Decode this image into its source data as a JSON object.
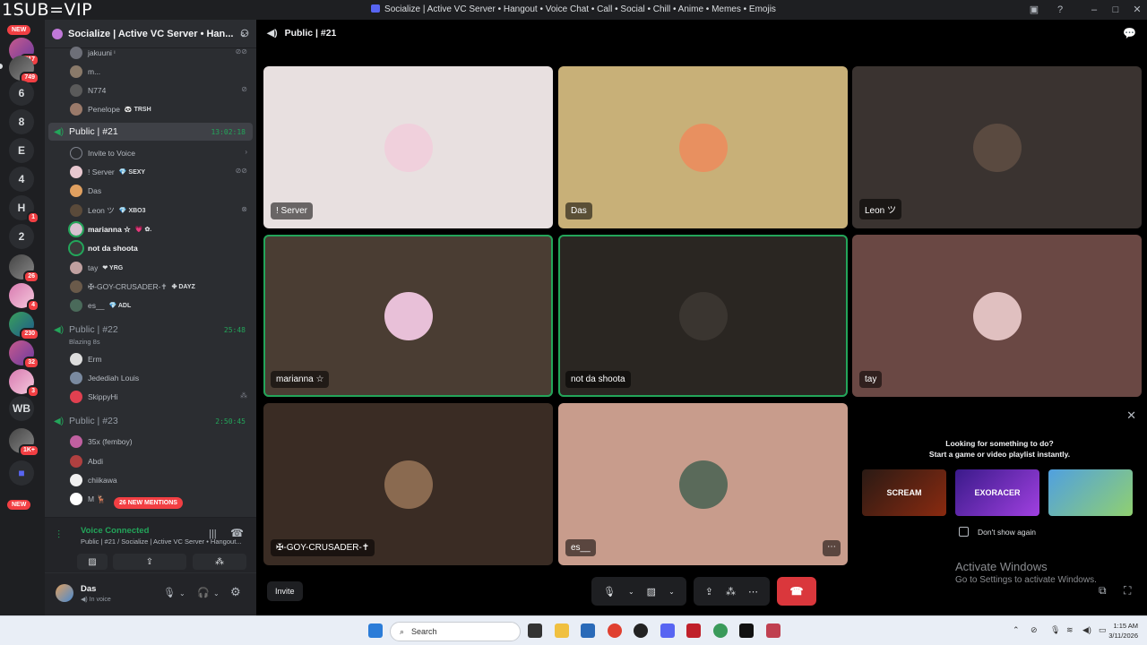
{
  "watermark": "1SUB=VIP",
  "window_title": "Socialize | Active VC Server • Hangout • Voice Chat • Call • Social • Chill • Anime • Memes • Emojis",
  "rail": {
    "new_top": "NEW",
    "new_bottom": "NEW",
    "items": [
      {
        "label": "",
        "badge": "517"
      },
      {
        "label": "",
        "badge": "749"
      },
      {
        "label": "6",
        "badge": ""
      },
      {
        "label": "8",
        "badge": ""
      },
      {
        "label": "E",
        "badge": ""
      },
      {
        "label": "4",
        "badge": ""
      },
      {
        "label": "H",
        "badge": "1"
      },
      {
        "label": "2",
        "badge": ""
      },
      {
        "label": "",
        "badge": "26"
      },
      {
        "label": "",
        "badge": "4"
      },
      {
        "label": "",
        "badge": "230"
      },
      {
        "label": "",
        "badge": "32"
      },
      {
        "label": "",
        "badge": "3"
      },
      {
        "label": "WB",
        "badge": ""
      },
      {
        "label": "",
        "badge": "1K+"
      }
    ]
  },
  "guild": {
    "name": "Socialize | Active VC Server • Han..."
  },
  "sidebar": {
    "top_users": [
      {
        "name": "jakuuni ᶦ",
        "color": "#6d6f78"
      },
      {
        "name": "m...",
        "color": "#8a7a6a"
      },
      {
        "name": "N774",
        "color": "#5a5a5a"
      },
      {
        "name": "Penelope",
        "tag": "🐼 TRSH",
        "color": "#9a7a6a"
      }
    ],
    "channel1": {
      "name": "Public | #21",
      "timer": "13:02:18"
    },
    "invite_label": "Invite to Voice",
    "ch1_users": [
      {
        "name": "! Server",
        "tag": "💎 SEXY",
        "color": "#e8c8d0",
        "bold": false
      },
      {
        "name": "Das",
        "tag": "",
        "color": "#e0a060",
        "bold": false
      },
      {
        "name": "Leon ツ",
        "tag": "💎 XBO3",
        "color": "#5a4a3a",
        "bold": false
      },
      {
        "name": "marianna ☆",
        "tag": "💗 ✿.",
        "color": "#d8c0d0",
        "bold": true
      },
      {
        "name": "not da shoota",
        "tag": "",
        "color": "#3a3a3a",
        "bold": true
      },
      {
        "name": "tay",
        "tag": "❤ YRG",
        "color": "#c0a0a0",
        "bold": false
      },
      {
        "name": "✠-GOY-CRUSADER-✝",
        "tag": "✤ DAYZ",
        "color": "#6a5a4a",
        "bold": false
      },
      {
        "name": "es__",
        "tag": "💎 ADL",
        "color": "#4a6a5a",
        "bold": false
      }
    ],
    "channel2": {
      "name": "Public | #22",
      "timer": "25:48",
      "sub": "Blazing 8s"
    },
    "ch2_users": [
      {
        "name": "Erm",
        "color": "#dddddd"
      },
      {
        "name": "Jedediah Louis",
        "color": "#7a8aa0"
      },
      {
        "name": "SkippyHi",
        "color": "#e04050"
      }
    ],
    "channel3": {
      "name": "Public | #23",
      "timer": "2:50:45"
    },
    "ch3_users": [
      {
        "name": "35x (femboy)",
        "color": "#c060a0"
      },
      {
        "name": "Abdi",
        "color": "#b04040"
      },
      {
        "name": "chiikawa",
        "color": "#f0f0f0"
      },
      {
        "name": "M 🦌",
        "color": "#ffffff"
      }
    ],
    "mentions": "26 NEW MENTIONS",
    "voice": {
      "status": "Voice Connected",
      "location": "Public | #21 / Socialize | Active VC Server • Hangout..."
    },
    "user": {
      "name": "Das",
      "status": "In voice"
    }
  },
  "stage": {
    "channel_title": "Public | #21",
    "tiles": [
      {
        "name": "! Server",
        "bg": "#e8e0e0",
        "av": "#f0d0dc",
        "speaking": false
      },
      {
        "name": "Das",
        "bg": "#c8b078",
        "av": "#e89060",
        "speaking": false
      },
      {
        "name": "Leon ツ",
        "bg": "#3a3330",
        "av": "#5a4a40",
        "speaking": false
      },
      {
        "name": "marianna ☆",
        "bg": "#4a3d33",
        "av": "#e8c0d8",
        "speaking": true
      },
      {
        "name": "not da shoota",
        "bg": "#2a2622",
        "av": "#3a3530",
        "speaking": true
      },
      {
        "name": "tay",
        "bg": "#6a4844",
        "av": "#e0c0c0",
        "speaking": false
      },
      {
        "name": "✠-GOY-CRUSADER-✝",
        "bg": "#3a2c24",
        "av": "#8a6a50",
        "speaking": false
      },
      {
        "name": "es__",
        "bg": "#c89c8c",
        "av": "#5a6a5a",
        "speaking": false
      }
    ],
    "promo": {
      "title": "Looking for something to do?",
      "subtitle": "Start a game or video playlist instantly.",
      "games": [
        "SCREAM",
        "EXORACER",
        ""
      ],
      "dont_show": "Don't show again"
    },
    "activate_title": "Activate Windows",
    "activate_sub": "Go to Settings to activate Windows.",
    "invite_label": "Invite"
  },
  "taskbar": {
    "search": "Search",
    "time": "1:15 AM",
    "date": "3/11/2026"
  }
}
